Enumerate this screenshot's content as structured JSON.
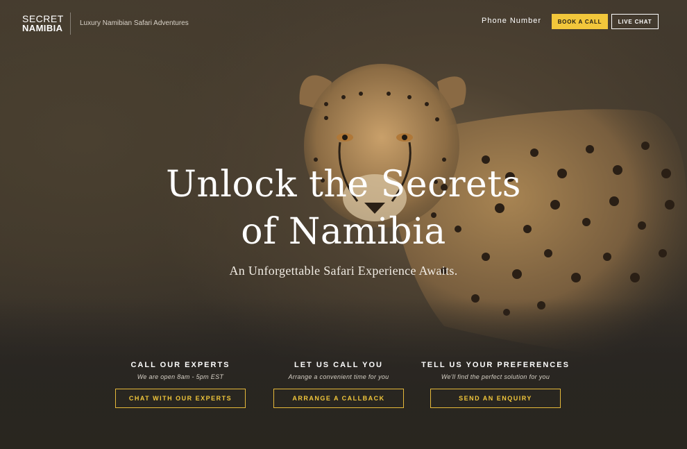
{
  "header": {
    "logo_line1": "SECRET",
    "logo_line2": "NAMIBIA",
    "tagline": "Luxury Namibian Safari Adventures",
    "phone_label": "Phone Number",
    "book_call_label": "BOOK A CALL",
    "live_chat_label": "LIVE CHAT"
  },
  "hero": {
    "headline_line1": "Unlock the Secrets",
    "headline_line2": "of Namibia",
    "subheadline": "An Unforgettable Safari Experience Awaits."
  },
  "cta": [
    {
      "title": "CALL OUR EXPERTS",
      "subtitle": "We are open 8am - 5pm EST",
      "button": "CHAT WITH OUR EXPERTS"
    },
    {
      "title": "LET US CALL YOU",
      "subtitle": "Arrange a convenient time for you",
      "button": "ARRANGE A CALLBACK"
    },
    {
      "title": "TELL US YOUR PREFERENCES",
      "subtitle": "We'll find the perfect solution for you",
      "button": "SEND AN ENQUIRY"
    }
  ],
  "colors": {
    "accent": "#f2c73b",
    "background": "#2a2724"
  }
}
